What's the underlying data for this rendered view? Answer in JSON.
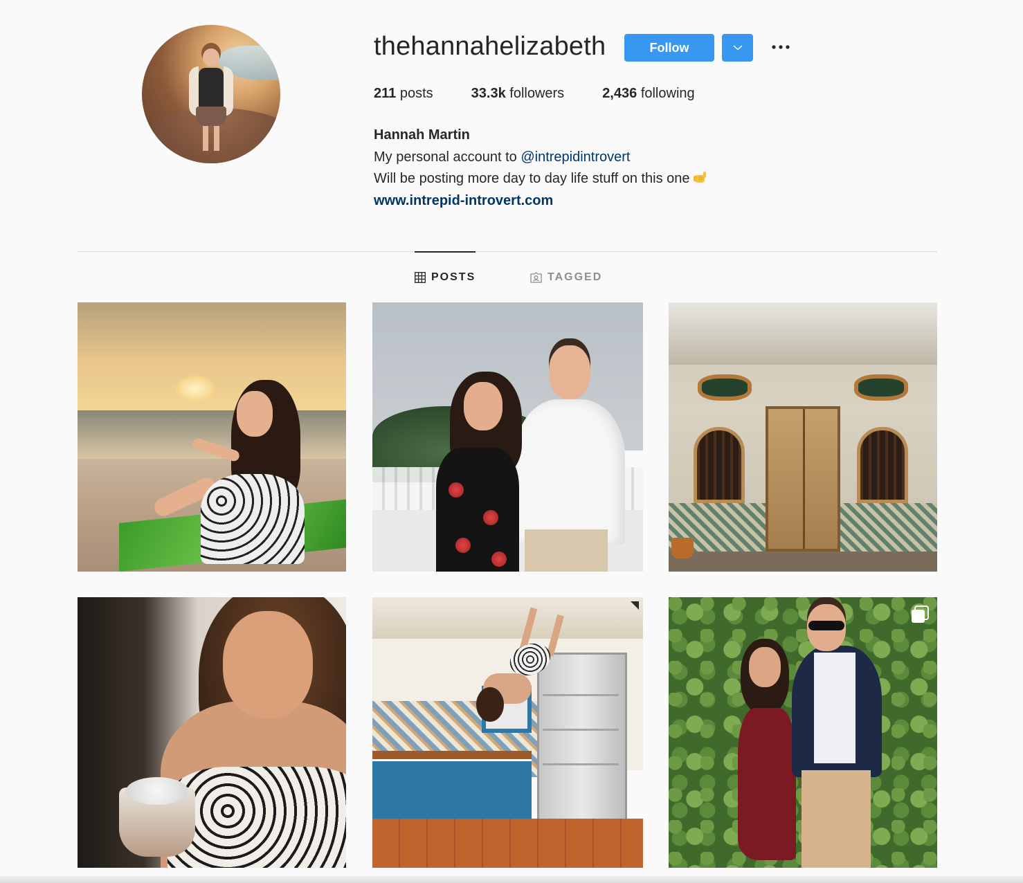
{
  "profile": {
    "username": "thehannahelizabeth",
    "follow_label": "Follow",
    "stats": {
      "posts_count": "211",
      "posts_label": "posts",
      "followers_count": "33.3k",
      "followers_label": "followers",
      "following_count": "2,436",
      "following_label": "following"
    },
    "bio": {
      "full_name": "Hannah Martin",
      "line1_prefix": "My personal account to ",
      "line1_mention": "@intrepidintrovert",
      "line2": "Will be posting more day to day life stuff on this one",
      "line2_emoji": "call-me-hand-emoji",
      "website": "www.intrepid-introvert.com"
    }
  },
  "tabs": [
    {
      "label": "POSTS",
      "icon": "grid-icon",
      "active": true
    },
    {
      "label": "TAGGED",
      "icon": "tagged-icon",
      "active": false
    }
  ],
  "posts": [
    {
      "subject": "woman on beach at sunset"
    },
    {
      "subject": "couple on balcony"
    },
    {
      "subject": "old shophouse doorway"
    },
    {
      "subject": "woman with ice cream"
    },
    {
      "subject": "upside-down kitchen illusion"
    },
    {
      "subject": "couple in front of ivy wall",
      "multi": true
    }
  ],
  "colors": {
    "accent": "#3897f0",
    "link": "#003569",
    "text": "#262626",
    "muted": "#8e8e8e",
    "background": "#fafafa"
  }
}
